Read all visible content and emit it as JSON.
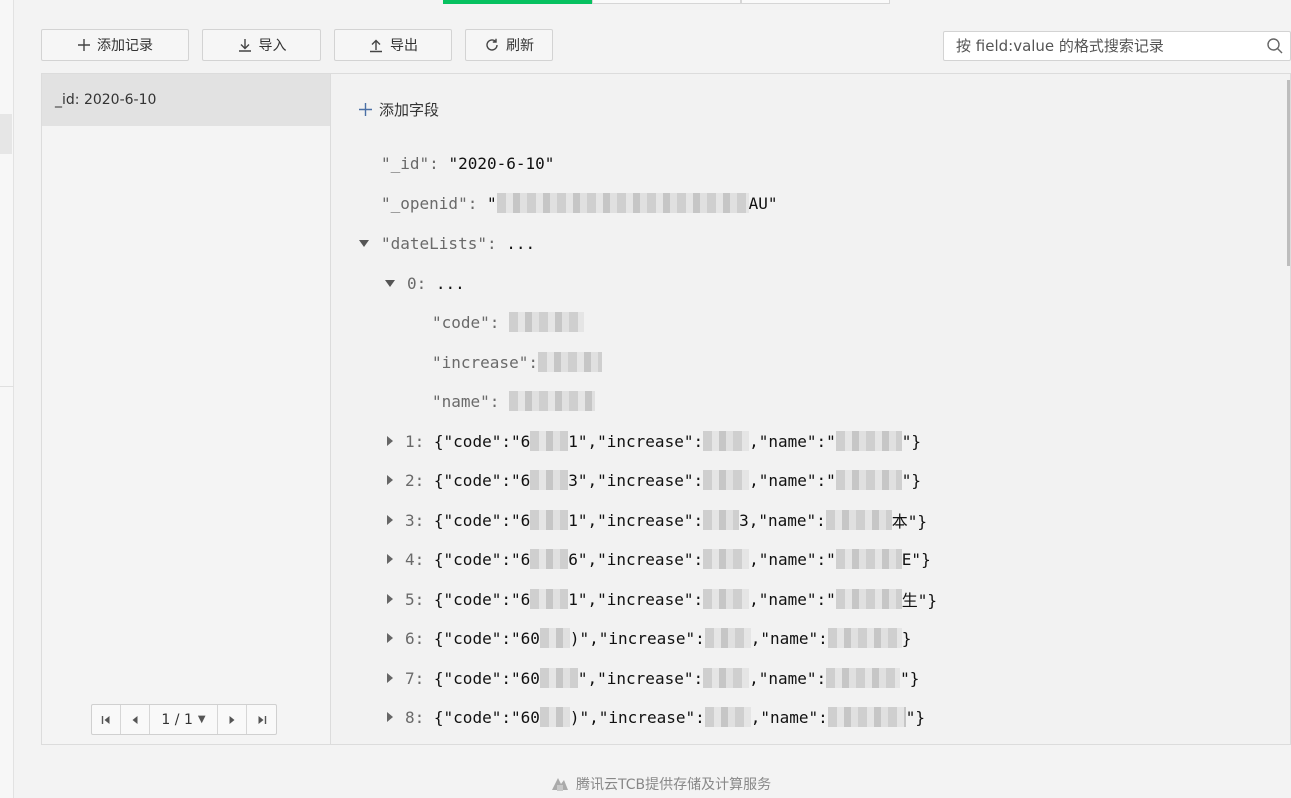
{
  "toolbar": {
    "add_label": "添加记录",
    "import_label": "导入",
    "export_label": "导出",
    "refresh_label": "刷新"
  },
  "search": {
    "placeholder": "按 field:value 的格式搜索记录"
  },
  "records": [
    {
      "label": "_id: 2020-6-10"
    }
  ],
  "pager": {
    "page_text": "1 / 1"
  },
  "detail": {
    "add_field_label": "添加字段",
    "id_key": "\"_id\":",
    "id_value": "\"2020-6-10\"",
    "openid_key": "\"_openid\":",
    "openid_prefix": "\"",
    "openid_suffix": "AU\"",
    "datelists_key": "\"dateLists\":",
    "datelists_value": "...",
    "item0_key": "0:",
    "item0_value": "...",
    "code_key": "\"code\":",
    "increase_key": "\"increase\":",
    "name_key": "\"name\":",
    "items": [
      {
        "index": "1:",
        "code_text": "{\"code\":\"6",
        "code_tail": "1\",\"increase\":",
        "name_part": ",\"name\":\"",
        "end": "\"}"
      },
      {
        "index": "2:",
        "code_text": "{\"code\":\"6",
        "code_tail": "3\",\"increase\":",
        "name_part": ",\"name\":\"",
        "end": "\"}"
      },
      {
        "index": "3:",
        "code_text": "{\"code\":\"6",
        "code_tail": "1\",\"increase\":",
        "name_part": "3,\"name\":",
        "end": "本\"}"
      },
      {
        "index": "4:",
        "code_text": "{\"code\":\"6",
        "code_tail": "6\",\"increase\":",
        "name_part": ",\"name\":\"",
        "end": "E\"}"
      },
      {
        "index": "5:",
        "code_text": "{\"code\":\"6",
        "code_tail": "1\",\"increase\":",
        "name_part": ",\"name\":\"",
        "end": "生\"}"
      },
      {
        "index": "6:",
        "code_text": "{\"code\":\"60",
        "code_tail": ")\",\"increase\":",
        "name_part": ",\"name\":",
        "end": "}"
      },
      {
        "index": "7:",
        "code_text": "{\"code\":\"60",
        "code_tail": "\",\"increase\":",
        "name_part": ",\"name\":",
        "end": "\"}"
      },
      {
        "index": "8:",
        "code_text": "{\"code\":\"60",
        "code_tail": ")\",\"increase\":",
        "name_part": ",\"name\":",
        "end": "\"}"
      }
    ]
  },
  "footer": {
    "text": "腾讯云TCB提供存储及计算服务"
  },
  "colors": {
    "accent": "#07c160"
  }
}
